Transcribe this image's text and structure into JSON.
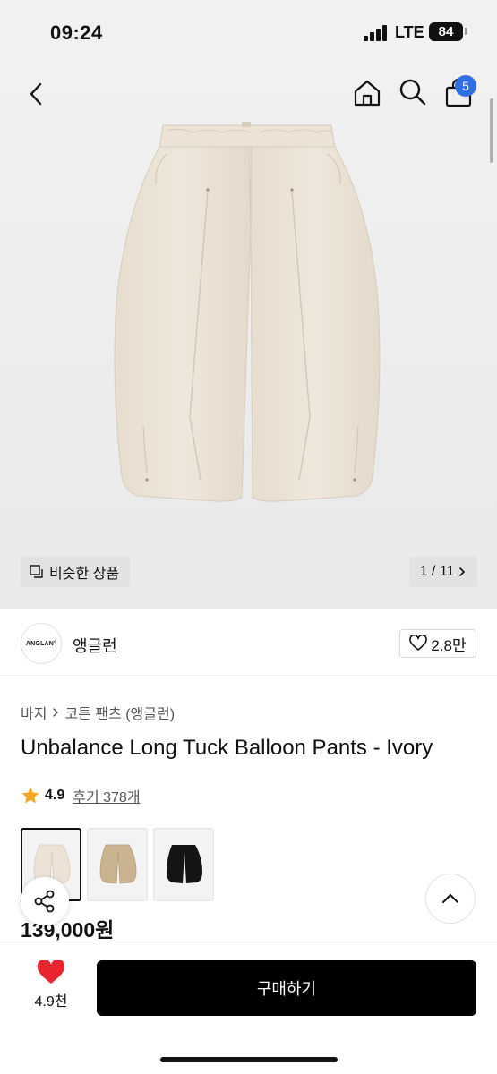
{
  "status_bar": {
    "time": "09:24",
    "network": "LTE",
    "battery": "84"
  },
  "header": {
    "cart_count": "5",
    "icons": [
      "chevron-left-icon",
      "home-icon",
      "search-icon",
      "shopping-bag-icon"
    ]
  },
  "gallery": {
    "similar_label": "비슷한 상품",
    "counter": "1 / 11",
    "current_image": 1,
    "total_images": 11
  },
  "brand": {
    "logo_text": "ANGLAN°",
    "name": "앵글런",
    "likes": "2.8만"
  },
  "product": {
    "breadcrumb": [
      "바지",
      "코튼 팬츠 (앵글런)"
    ],
    "title": "Unbalance Long Tuck Balloon Pants - Ivory",
    "rating": "4.9",
    "reviews": "후기 378개",
    "price": "139,000원",
    "swatches": [
      {
        "color": "#ece3d6",
        "selected": true
      },
      {
        "color": "#c9b48f",
        "selected": false
      },
      {
        "color": "#141414",
        "selected": false
      }
    ]
  },
  "bottom_bar": {
    "wish_count": "4.9천",
    "buy_label": "구매하기"
  },
  "colors": {
    "accent_blue": "#2f6fe4",
    "star": "#f5a623",
    "heart": "#e8242f",
    "pants_ivory": "#ece3d6"
  }
}
